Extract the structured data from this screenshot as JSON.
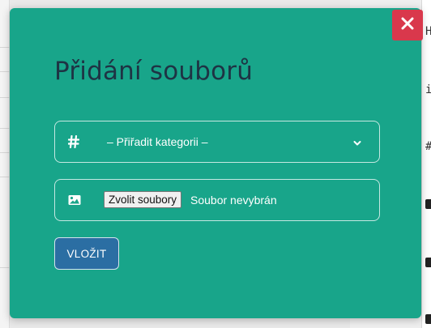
{
  "background": {
    "right_chars": [
      "H",
      "i",
      "#"
    ]
  },
  "modal": {
    "title": "Přidání souborů",
    "category_select": {
      "icon": "hash-icon",
      "selected": "– Přiřadit kategorii –"
    },
    "file_input": {
      "icon": "image-icon",
      "button_label": "Zvolit soubory",
      "status": "Soubor nevybrán"
    },
    "submit_label": "VLOŽIT",
    "close_icon": "close-icon"
  },
  "colors": {
    "modal_bg": "#18a58a",
    "title": "#1e3344",
    "submit_bg": "#2b6ea3",
    "close_bg": "#d9384c"
  }
}
